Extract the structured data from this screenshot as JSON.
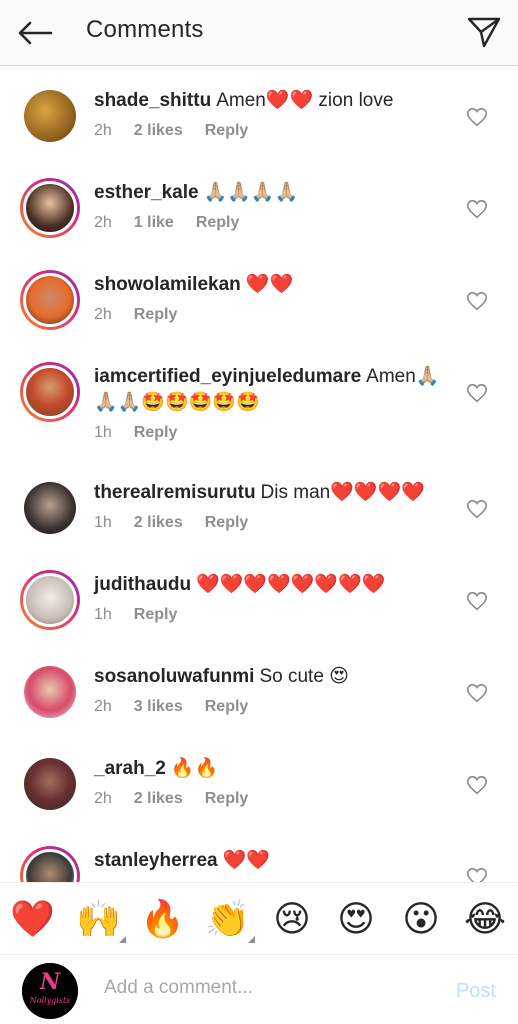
{
  "header": {
    "title": "Comments"
  },
  "comments": [
    {
      "username": "shade_shittu",
      "text": "Amen❤️❤️ zion love",
      "time": "2h",
      "likes": "2 likes",
      "reply": "Reply"
    },
    {
      "username": "esther_kale",
      "text": "🙏🏼🙏🏼🙏🏼🙏🏼",
      "time": "2h",
      "likes": "1 like",
      "reply": "Reply"
    },
    {
      "username": "showolamilekan",
      "text": "❤️❤️",
      "time": "2h",
      "likes": "",
      "reply": "Reply"
    },
    {
      "username": "iamcertified_eyinjueledumare",
      "text": "Amen🙏🏼🙏🏼🙏🏼🤩🤩🤩🤩🤩",
      "time": "1h",
      "likes": "",
      "reply": "Reply"
    },
    {
      "username": "therealremisurutu",
      "text": "Dis man❤️❤️❤️❤️",
      "time": "1h",
      "likes": "2 likes",
      "reply": "Reply"
    },
    {
      "username": "judithaudu",
      "text": "❤️❤️❤️❤️❤️❤️❤️❤️",
      "time": "1h",
      "likes": "",
      "reply": "Reply"
    },
    {
      "username": "sosanoluwafunmi",
      "text": "So cute 😍",
      "time": "2h",
      "likes": "3 likes",
      "reply": "Reply"
    },
    {
      "username": "_arah_2",
      "text": "🔥🔥",
      "time": "2h",
      "likes": "2 likes",
      "reply": "Reply"
    },
    {
      "username": "stanleyherrea",
      "text": "❤️❤️",
      "time": "",
      "likes": "",
      "reply": ""
    }
  ],
  "emoji_bar": [
    "❤️",
    "🙌",
    "🔥",
    "👏",
    "😢",
    "😍",
    "😮",
    "😂"
  ],
  "composer": {
    "placeholder": "Add a comment...",
    "post_label": "Post",
    "avatar_text": "Nollygists"
  },
  "colors": {
    "accent": "#0095f6",
    "post_disabled": "#c0dffd",
    "heart": "#ed4956"
  }
}
